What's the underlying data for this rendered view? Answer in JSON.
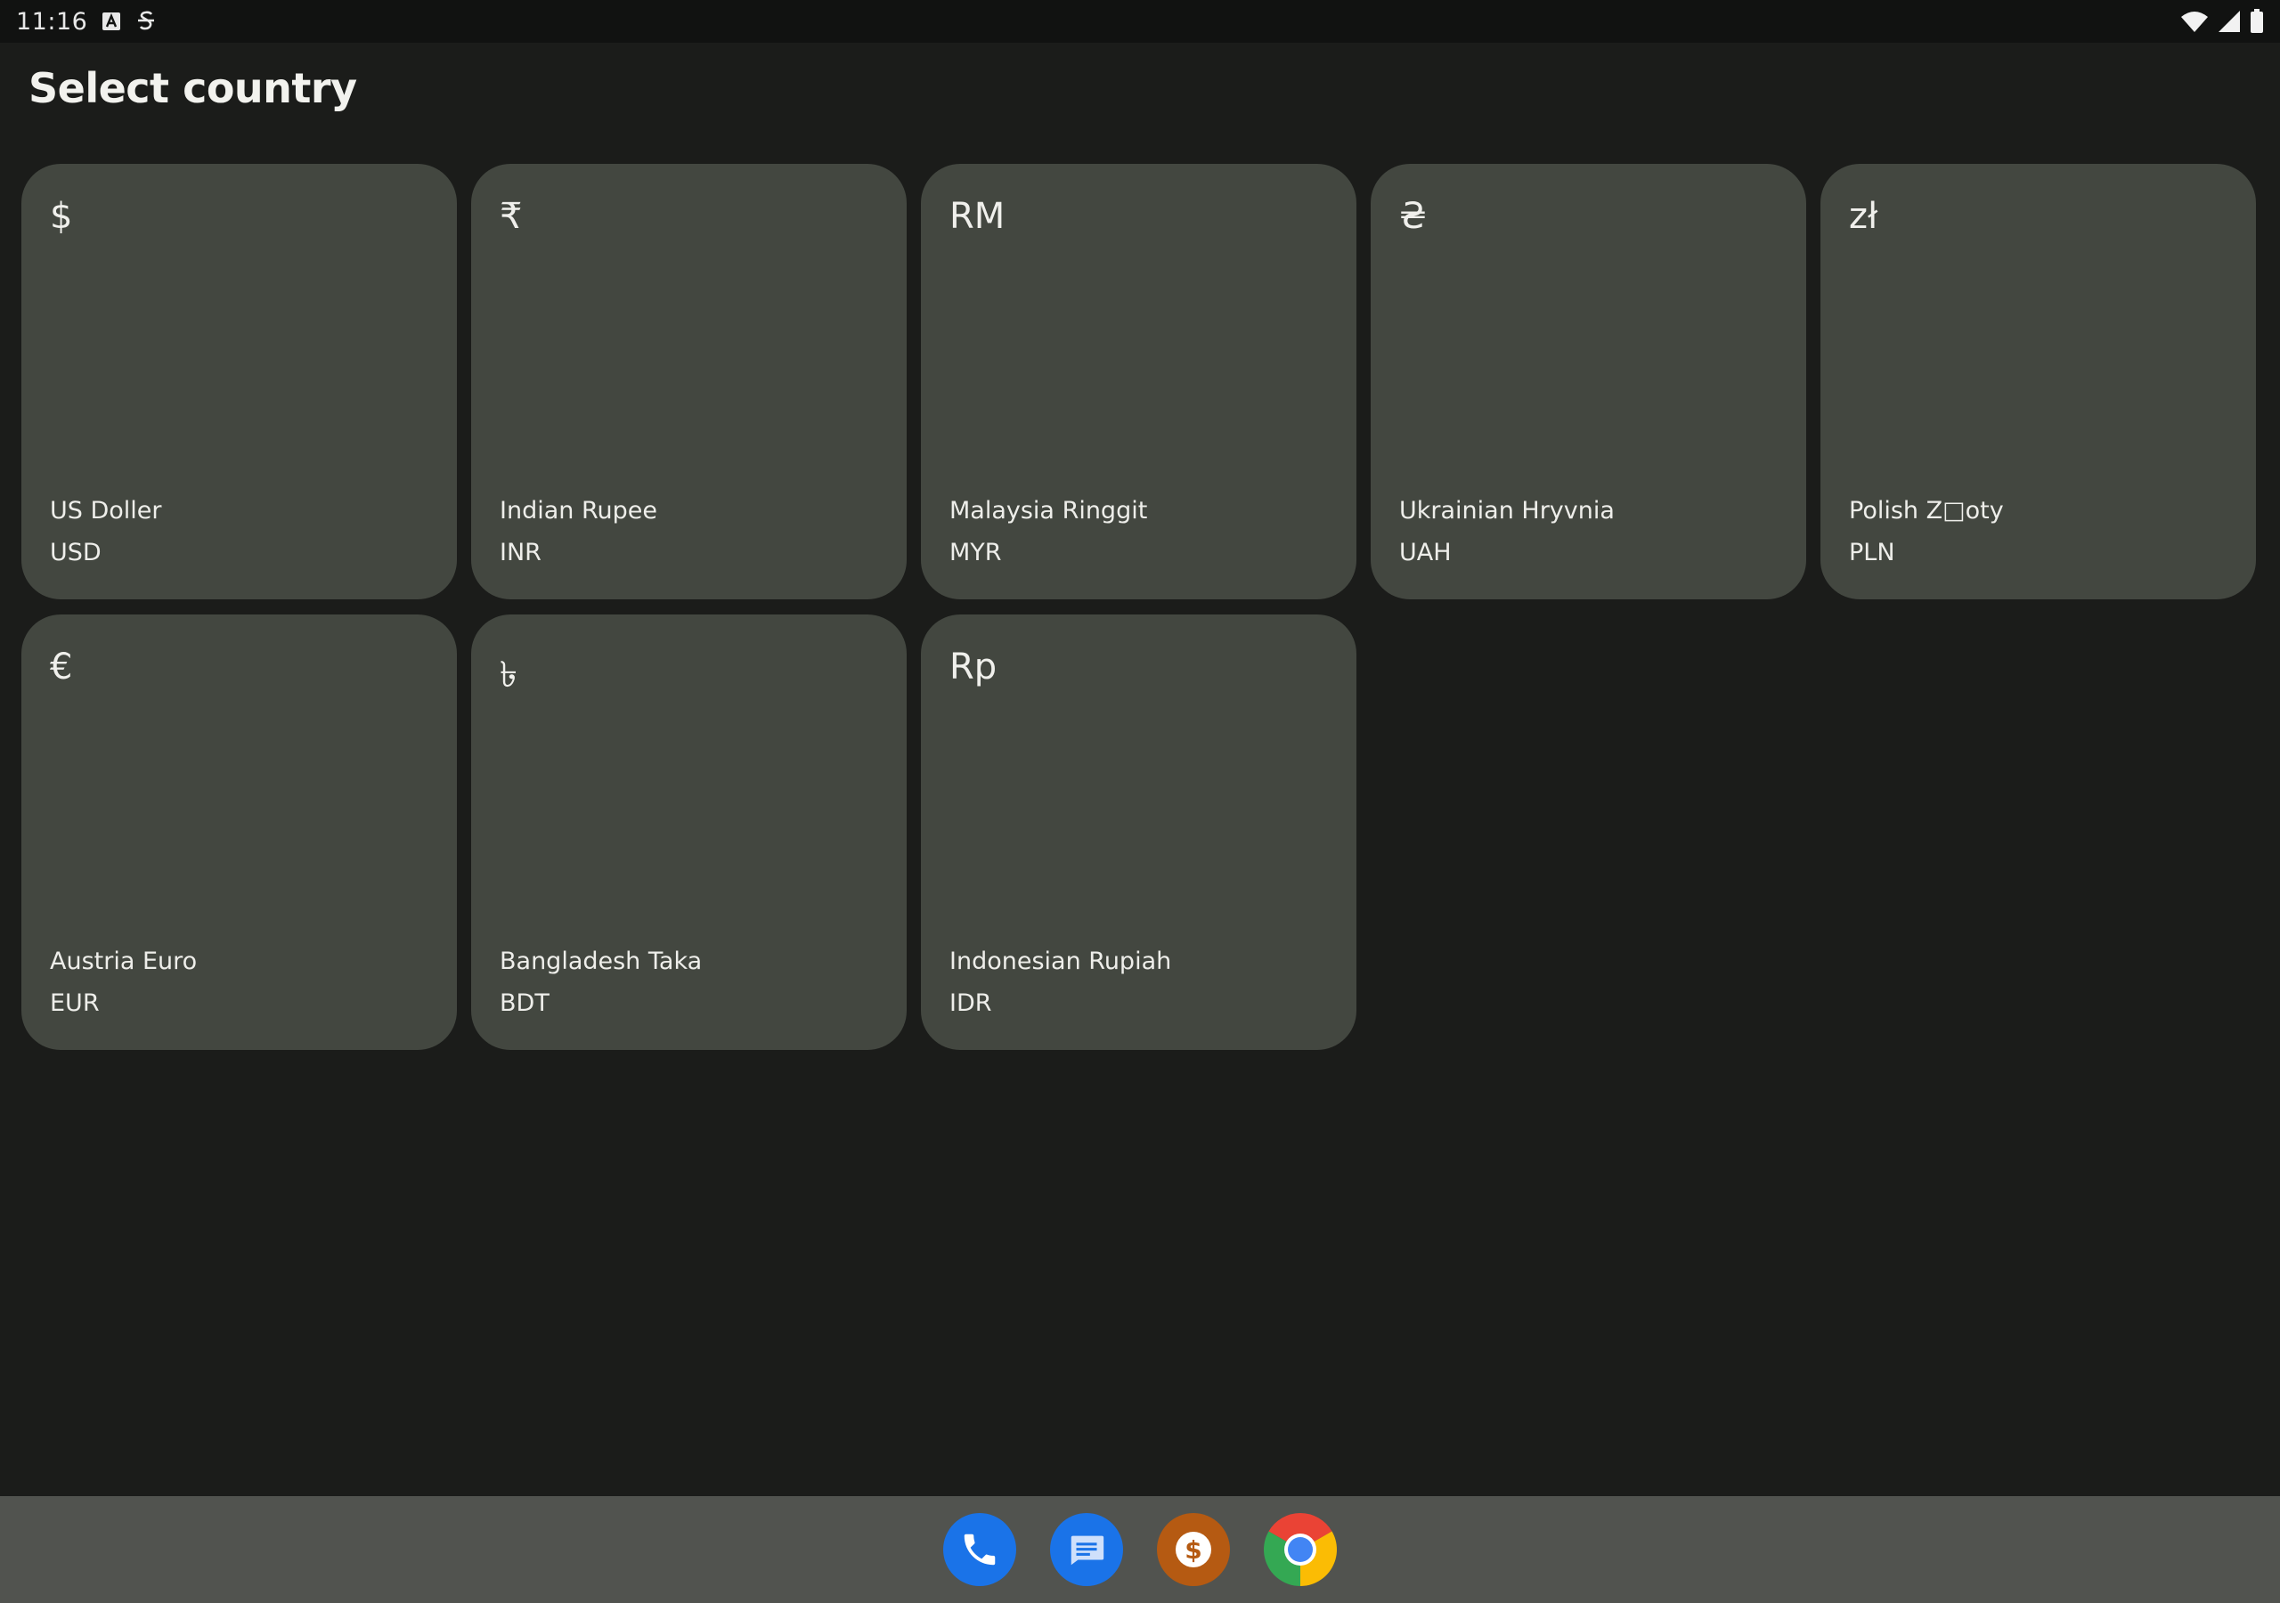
{
  "status_bar": {
    "time": "11:16",
    "icons_left": [
      "a-notification-icon",
      "s-notification-icon"
    ],
    "icons_right": [
      "wifi-icon",
      "signal-icon",
      "battery-icon"
    ]
  },
  "page": {
    "title": "Select country"
  },
  "currencies": [
    {
      "symbol": "$",
      "name": "US Doller",
      "code": "USD"
    },
    {
      "symbol": "₹",
      "name": "Indian Rupee",
      "code": "INR"
    },
    {
      "symbol": "RM",
      "name": "Malaysia Ringgit",
      "code": "MYR"
    },
    {
      "symbol": "₴",
      "name": "Ukrainian Hryvnia",
      "code": "UAH"
    },
    {
      "symbol": "zł",
      "name": "Polish Z□oty",
      "code": "PLN"
    },
    {
      "symbol": "€",
      "name": "Austria Euro",
      "code": "EUR"
    },
    {
      "symbol": "৳",
      "name": "Bangladesh Taka",
      "code": "BDT"
    },
    {
      "symbol": "Rp",
      "name": "Indonesian Rupiah",
      "code": "IDR"
    }
  ],
  "taskbar": {
    "apps": [
      "phone-app-icon",
      "messages-app-icon",
      "currency-app-icon",
      "chrome-app-icon"
    ]
  },
  "colors": {
    "background": "#1b1c1a",
    "card": "#434740",
    "taskbar": "#51534f",
    "status_bar": "#111211"
  }
}
